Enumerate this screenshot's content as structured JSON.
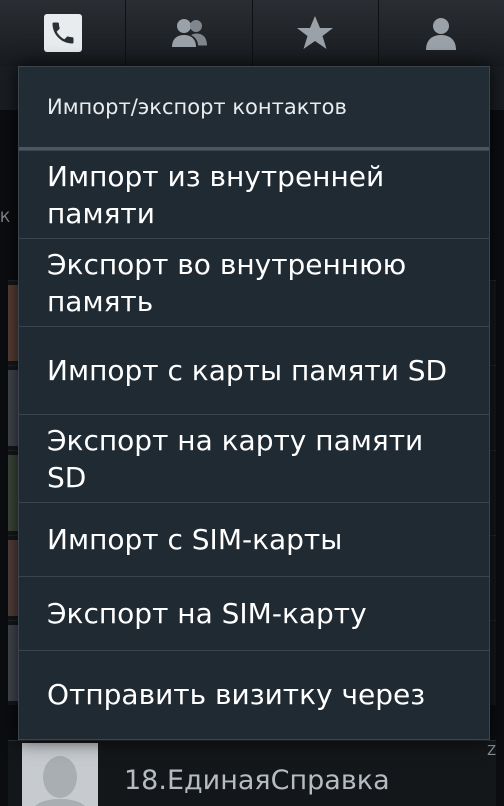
{
  "tabs": [
    {
      "name": "phone",
      "icon": "phone-icon",
      "selected": true
    },
    {
      "name": "groups",
      "icon": "groups-icon"
    },
    {
      "name": "favorites",
      "icon": "star-icon"
    },
    {
      "name": "contacts",
      "icon": "person-icon"
    }
  ],
  "dialog": {
    "title": "Импорт/экспорт контактов",
    "items": [
      {
        "label": "Импорт из внутренней памяти"
      },
      {
        "label": "Экспорт во внутреннюю память"
      },
      {
        "label": "Импорт с карты памяти SD"
      },
      {
        "label": "Экспорт на карту памяти SD"
      },
      {
        "label": "Импорт с SIM-карты"
      },
      {
        "label": "Экспорт на SIM-карту"
      },
      {
        "label": "Отправить визитку через"
      }
    ]
  },
  "contact": {
    "name": "18.ЕдинаяСправка",
    "avatar_icon": "person-silhouette-icon"
  },
  "index_letters": {
    "left": "К",
    "right": "Z"
  },
  "colors": {
    "dialog_bg": "#202a33",
    "title_text": "#e8ecef",
    "item_text": "#ffffff",
    "divider": "#3a4450"
  }
}
